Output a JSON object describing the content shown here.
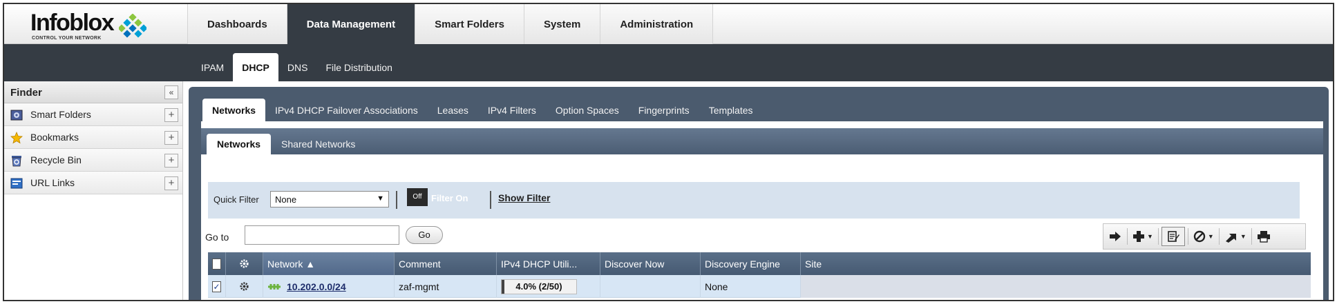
{
  "brand": {
    "name": "Infoblox",
    "tagline": "CONTROL YOUR NETWORK"
  },
  "main_nav": [
    {
      "label": "Dashboards",
      "active": false
    },
    {
      "label": "Data Management",
      "active": true
    },
    {
      "label": "Smart Folders",
      "active": false
    },
    {
      "label": "System",
      "active": false
    },
    {
      "label": "Administration",
      "active": false
    }
  ],
  "sub_nav": [
    {
      "label": "IPAM",
      "active": false
    },
    {
      "label": "DHCP",
      "active": true
    },
    {
      "label": "DNS",
      "active": false
    },
    {
      "label": "File Distribution",
      "active": false
    }
  ],
  "finder": {
    "title": "Finder",
    "collapse": "«",
    "items": [
      {
        "label": "Smart Folders",
        "icon": "smart-folder-icon"
      },
      {
        "label": "Bookmarks",
        "icon": "star-icon"
      },
      {
        "label": "Recycle Bin",
        "icon": "recycle-bin-icon"
      },
      {
        "label": "URL Links",
        "icon": "url-link-icon"
      }
    ],
    "add": "+"
  },
  "dhcp_tabs": [
    {
      "label": "Networks",
      "active": true
    },
    {
      "label": "IPv4 DHCP Failover Associations",
      "active": false
    },
    {
      "label": "Leases",
      "active": false
    },
    {
      "label": "IPv4 Filters",
      "active": false
    },
    {
      "label": "Option Spaces",
      "active": false
    },
    {
      "label": "Fingerprints",
      "active": false
    },
    {
      "label": "Templates",
      "active": false
    }
  ],
  "network_tabs": [
    {
      "label": "Networks",
      "active": true
    },
    {
      "label": "Shared Networks",
      "active": false
    }
  ],
  "filter": {
    "quick_filter_label": "Quick Filter",
    "quick_filter_value": "None",
    "toggle_off": "Off",
    "toggle_on": "Filter On",
    "show_filter": "Show Filter"
  },
  "goto": {
    "label": "Go to",
    "value": "",
    "button": "Go"
  },
  "toolbar": [
    "arrow-right-icon",
    "add-icon",
    "edit-icon",
    "block-icon",
    "export-icon",
    "print-icon"
  ],
  "grid": {
    "columns": [
      "",
      "",
      "Network ▲",
      "Comment",
      "IPv4 DHCP Utili...",
      "Discover Now",
      "Discovery Engine",
      "Site"
    ],
    "rows": [
      {
        "checked": true,
        "network": "10.202.0.0/24",
        "comment": "zaf-mgmt",
        "utilization_text": "4.0% (2/50)",
        "utilization": 0.04,
        "discover_now": "",
        "discovery_engine": "None",
        "site": ""
      }
    ]
  },
  "colors": {
    "nav_dark": "#353c44",
    "panel": "#4b5b6e",
    "grid_header": "#52657d",
    "row_selected": "#d7e6f5",
    "network_icon": "#6cb33f"
  }
}
